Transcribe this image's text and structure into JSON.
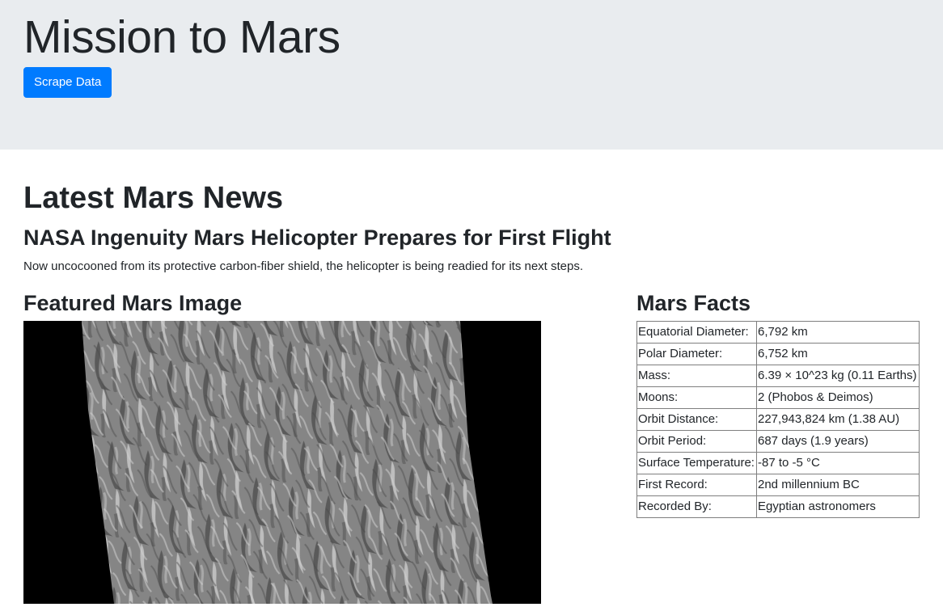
{
  "header": {
    "title": "Mission to Mars",
    "scrape_button": "Scrape Data"
  },
  "news": {
    "heading": "Latest Mars News",
    "title": "NASA Ingenuity Mars Helicopter Prepares for First Flight",
    "teaser": "Now uncocooned from its protective carbon-fiber shield, the helicopter is being readied for its next steps."
  },
  "featured": {
    "heading": "Featured Mars Image"
  },
  "facts": {
    "heading": "Mars Facts",
    "rows": [
      {
        "label": "Equatorial Diameter:",
        "value": "6,792 km"
      },
      {
        "label": "Polar Diameter:",
        "value": "6,752 km"
      },
      {
        "label": "Mass:",
        "value": "6.39 × 10^23 kg (0.11 Earths)"
      },
      {
        "label": "Moons:",
        "value": "2 (Phobos & Deimos)"
      },
      {
        "label": "Orbit Distance:",
        "value": "227,943,824 km (1.38 AU)"
      },
      {
        "label": "Orbit Period:",
        "value": "687 days (1.9 years)"
      },
      {
        "label": "Surface Temperature:",
        "value": "-87 to -5 °C"
      },
      {
        "label": "First Record:",
        "value": "2nd millennium BC"
      },
      {
        "label": "Recorded By:",
        "value": "Egyptian astronomers"
      }
    ]
  }
}
